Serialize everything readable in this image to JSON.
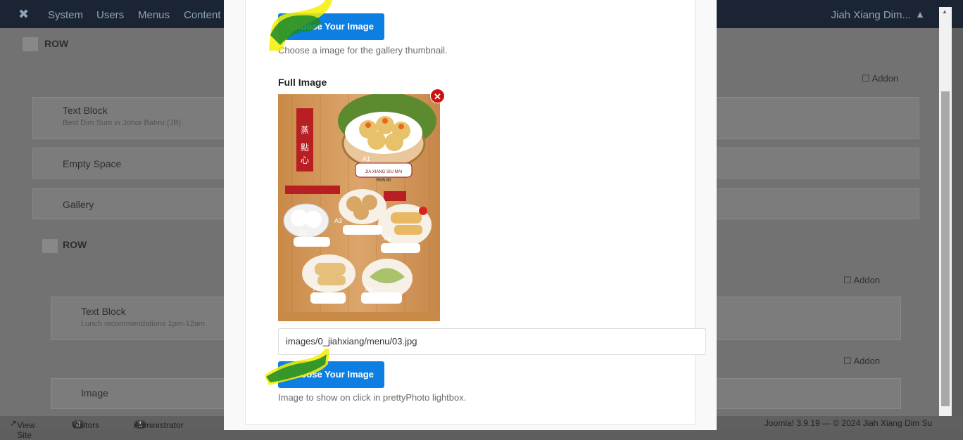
{
  "topbar": {
    "menus": [
      "System",
      "Users",
      "Menus",
      "Content"
    ],
    "user": "Jiah Xiang Dim..."
  },
  "background": {
    "row1": "ROW",
    "row2": "ROW",
    "addon": "Addon",
    "blocks": [
      {
        "title": "Text Block",
        "subtitle": "Best Dim Sum in Johor Bahru (JB)"
      },
      {
        "title": "Empty Space",
        "subtitle": ""
      },
      {
        "title": "Gallery",
        "subtitle": ""
      },
      {
        "title": "Text Block",
        "subtitle": "Lunch recommendations 1pm-12am"
      },
      {
        "title": "Image",
        "subtitle": ""
      }
    ]
  },
  "footer": {
    "view_site": "View Site",
    "visitors_count": "0",
    "visitors_label": "Visitors",
    "admin_count": "1",
    "admin_label": "Administrator",
    "version": "Joomla! 3.9.19 — © 2024 Jiah Xiang Dim Su"
  },
  "modal": {
    "thumb_button": "Choose Your Image",
    "thumb_help": "Choose a image for the gallery thumbnail.",
    "full_label": "Full Image",
    "full_path": "images/0_jiahxiang/menu/03.jpg",
    "full_button": "Choose Your Image",
    "full_help": "Image to show on click in prettyPhoto lightbox.",
    "remove_icon": "close-icon"
  },
  "menu_image": {
    "caption_a1": "A1",
    "name_a1": "JIA XIANG SIU MAI",
    "price_a1": "RM5.80",
    "caption_a2": "A2",
    "caption_a3": "A3",
    "caption_a4": "A4",
    "caption_a5": "A5",
    "caption_a6": "A6"
  },
  "colors": {
    "primary_button": "#0d7fe3",
    "remove": "#cc1111",
    "marker_yellow": "#f4f000",
    "marker_green": "#1a8a2a"
  }
}
